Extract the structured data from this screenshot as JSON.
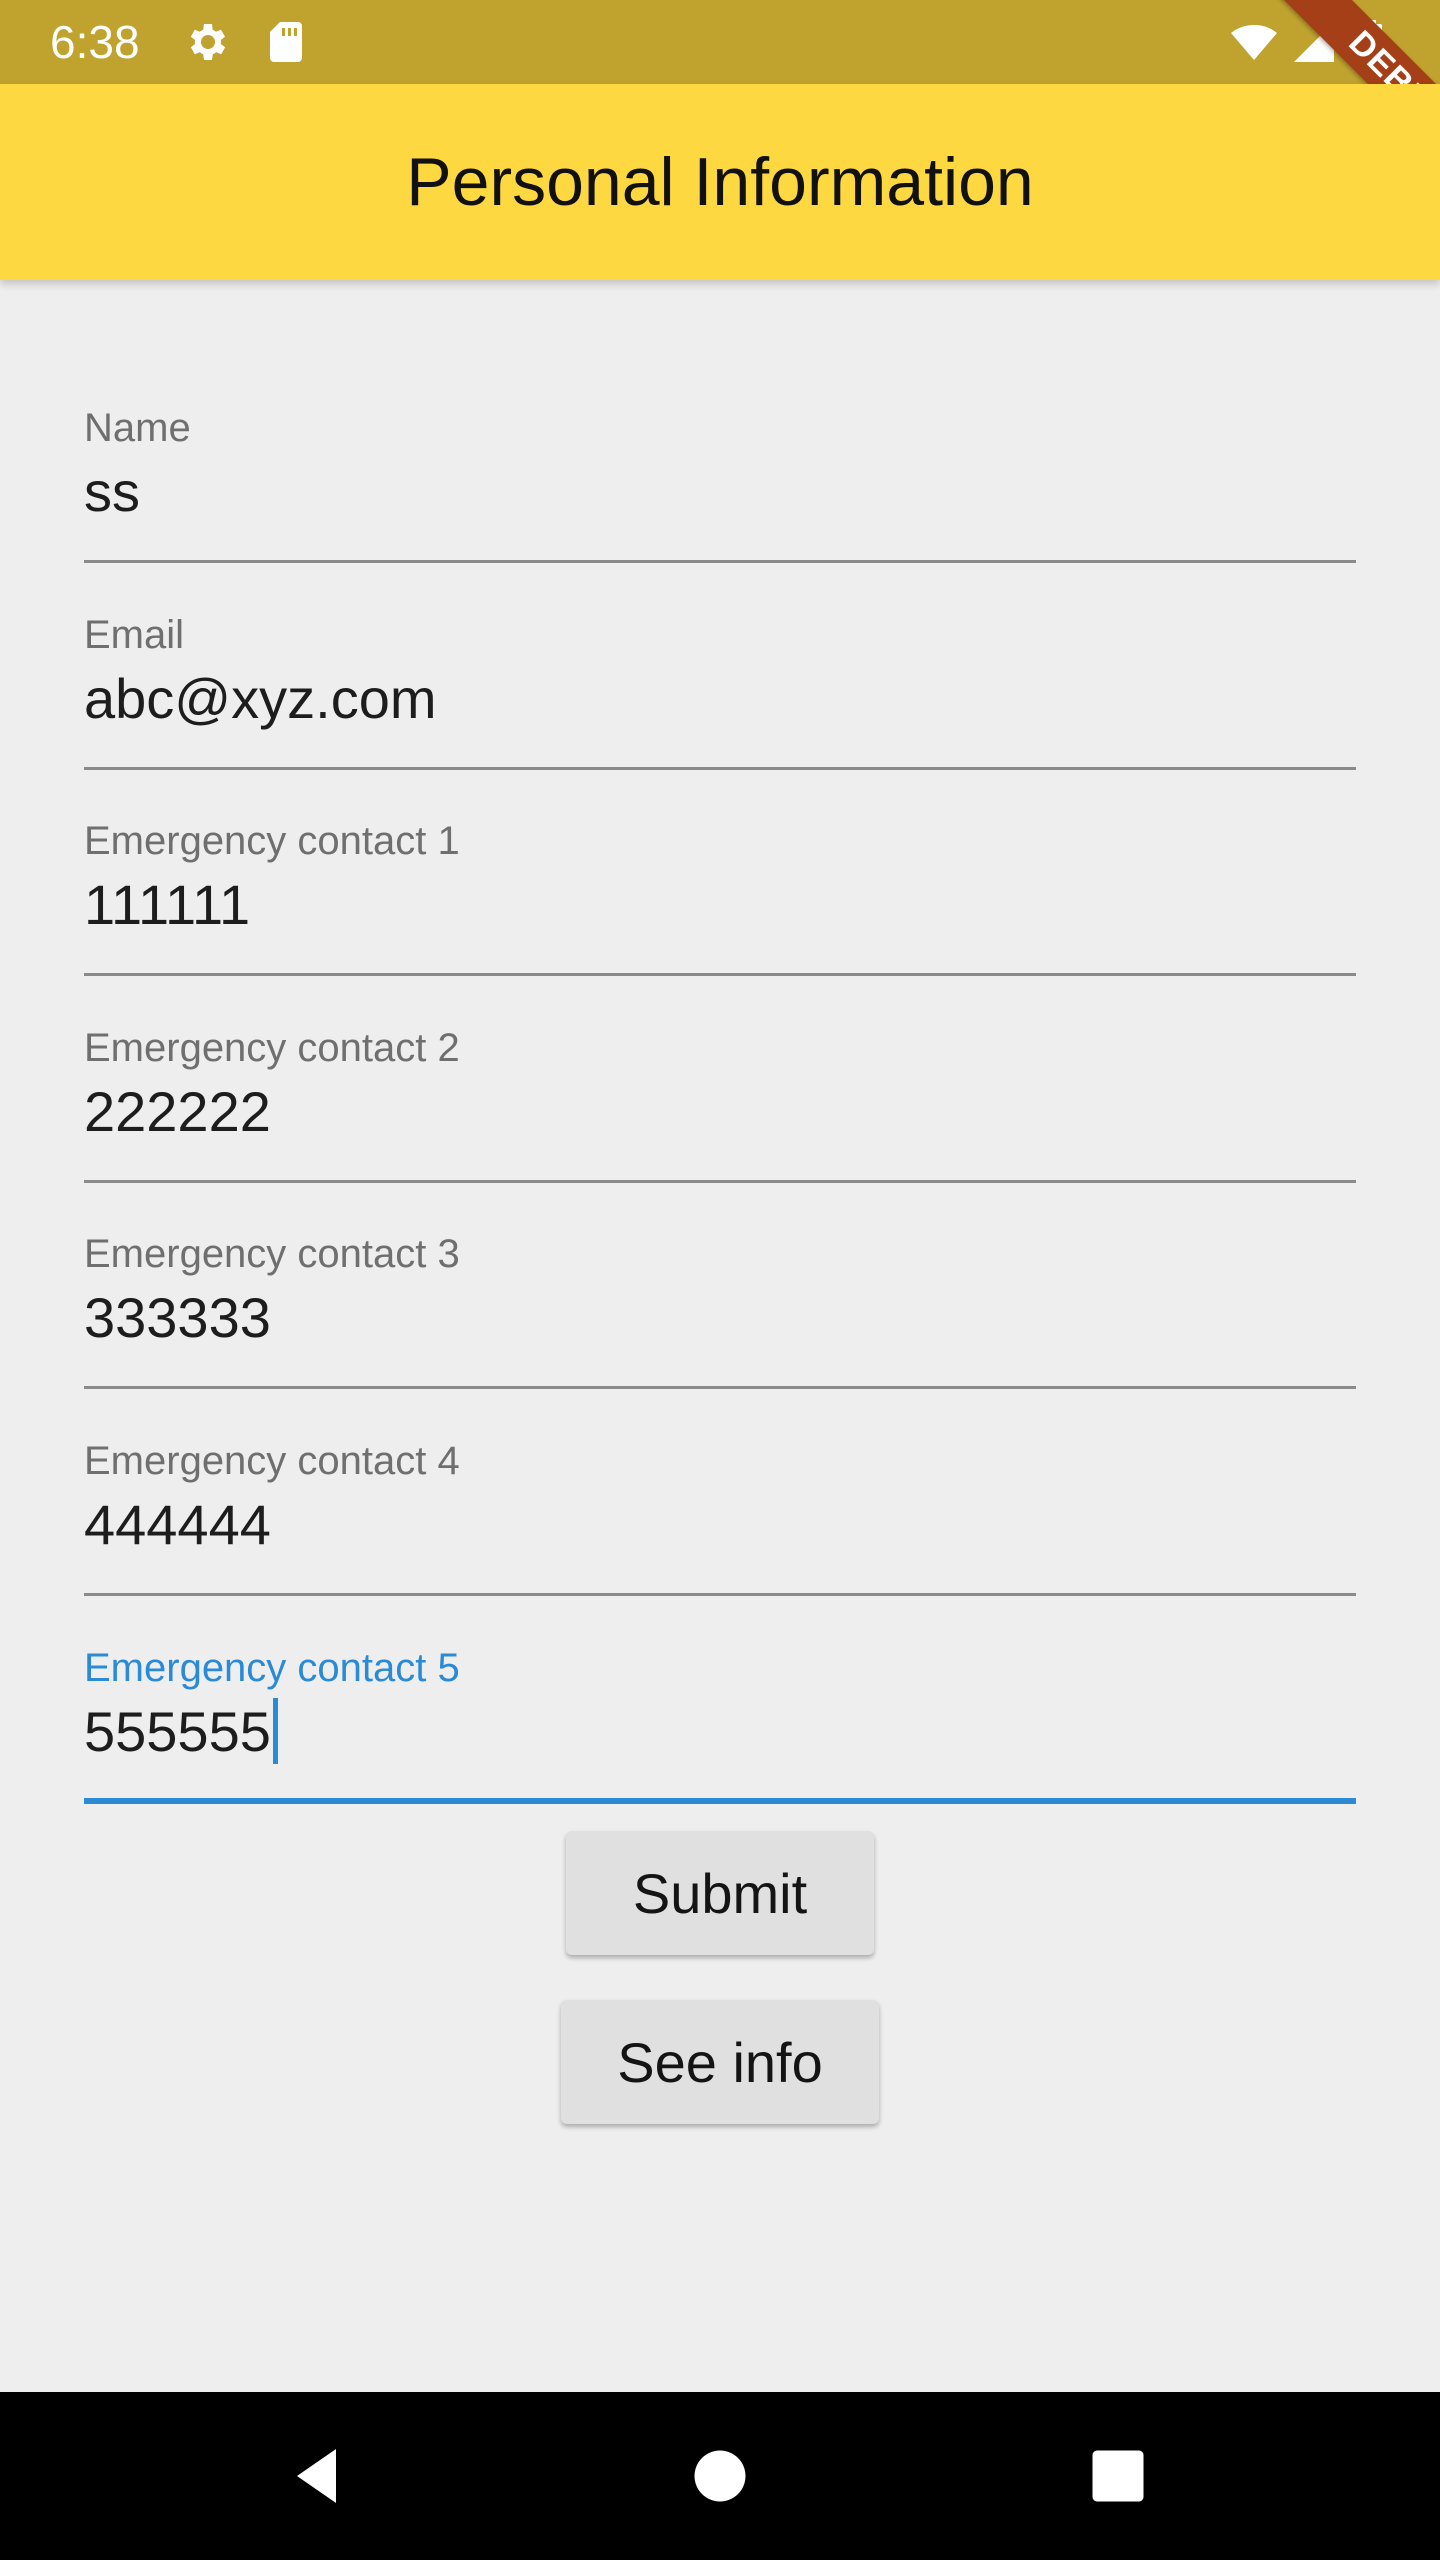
{
  "status_bar": {
    "time": "6:38",
    "icons": [
      "gear-icon",
      "sd-card-icon",
      "wifi-icon",
      "signal-icon",
      "battery-icon"
    ]
  },
  "debug_banner": {
    "label": "DEBUG"
  },
  "app_bar": {
    "title": "Personal Information"
  },
  "form": {
    "fields": [
      {
        "label": "Name",
        "value": "ss"
      },
      {
        "label": "Email",
        "value": "abc@xyz.com"
      },
      {
        "label": "Emergency contact 1",
        "value": "111111"
      },
      {
        "label": "Emergency contact 2",
        "value": "222222"
      },
      {
        "label": "Emergency contact 3",
        "value": "333333"
      },
      {
        "label": "Emergency contact 4",
        "value": "444444"
      },
      {
        "label": "Emergency contact 5",
        "value": "555555",
        "focused": true
      }
    ]
  },
  "buttons": {
    "submit_label": "Submit",
    "see_info_label": "See info"
  },
  "nav_bar": {
    "icons": [
      "back-icon",
      "home-icon",
      "recents-icon"
    ]
  },
  "colors": {
    "status_bar": "#c0a22e",
    "app_bar": "#fed840",
    "accent": "#2a8ad6",
    "debug_ribbon": "#a43f17"
  }
}
